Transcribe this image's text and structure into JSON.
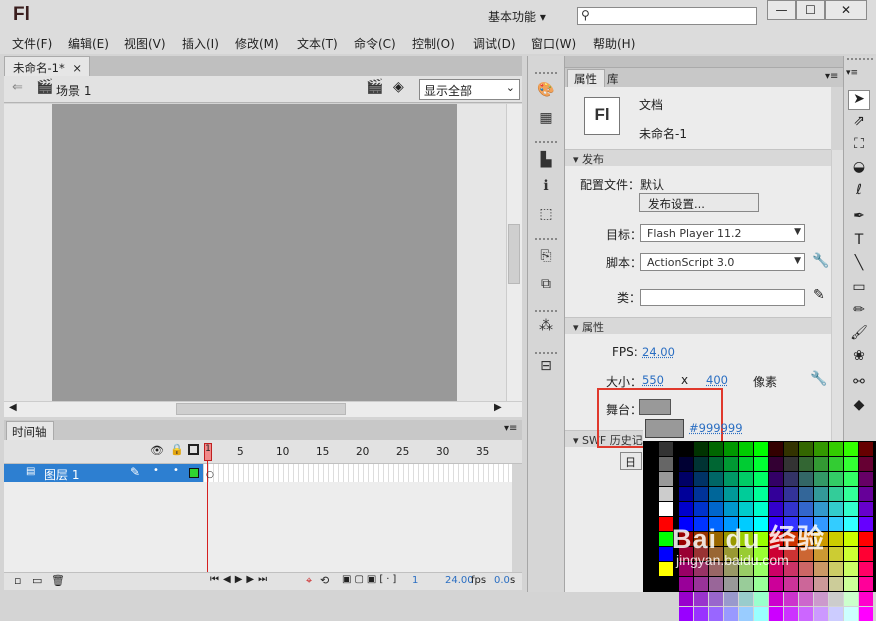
{
  "app": {
    "logo": "Fl",
    "workspace": "基本功能",
    "workspace_arrow": "▾",
    "search_value": "",
    "window_buttons": [
      "—",
      "☐",
      "✕"
    ]
  },
  "menu": [
    "文件(F)",
    "编辑(E)",
    "视图(V)",
    "插入(I)",
    "修改(M)",
    "文本(T)",
    "命令(C)",
    "控制(O)",
    "调试(D)",
    "窗口(W)",
    "帮助(H)"
  ],
  "document": {
    "tab_label": "未命名-1*",
    "tab_close": "×",
    "scene_label": "场景 1",
    "zoom": "显示全部",
    "stage_color": "#999999"
  },
  "timeline": {
    "tab_label": "时间轴",
    "frame_numbers": [
      "1",
      "5",
      "10",
      "15",
      "20",
      "25",
      "30",
      "35"
    ],
    "layer_name": "图层 1",
    "status_frame": "1",
    "status_fps": "24.00",
    "status_fps_unit": "fps",
    "status_time": "0.0",
    "status_time_unit": "s"
  },
  "panel": {
    "tab_properties": "属性",
    "tab_library": "库",
    "doc_icon": "Fl",
    "doc_type": "文档",
    "doc_name": "未命名-1",
    "publish": {
      "header": "发布",
      "profile_label": "配置文件：",
      "profile_value": "默认",
      "settings_button": "发布设置...",
      "target_label": "目标：",
      "target_value": "Flash Player 11.2",
      "script_label": "脚本：",
      "script_value": "ActionScript 3.0",
      "class_label": "类：",
      "class_value": ""
    },
    "properties": {
      "header": "属性",
      "fps_label": "FPS:",
      "fps_value": "24.00",
      "size_label": "大小：",
      "width": "550",
      "x": "x",
      "height": "400",
      "unit": "像素",
      "stage_label": "舞台："
    },
    "swf_history": {
      "header": "SWF 历史记",
      "button": "日"
    }
  },
  "color_popup": {
    "hex": "#999999"
  },
  "watermark": {
    "brand": "Bai du 经验",
    "url": "jingyan.baidu.com"
  }
}
